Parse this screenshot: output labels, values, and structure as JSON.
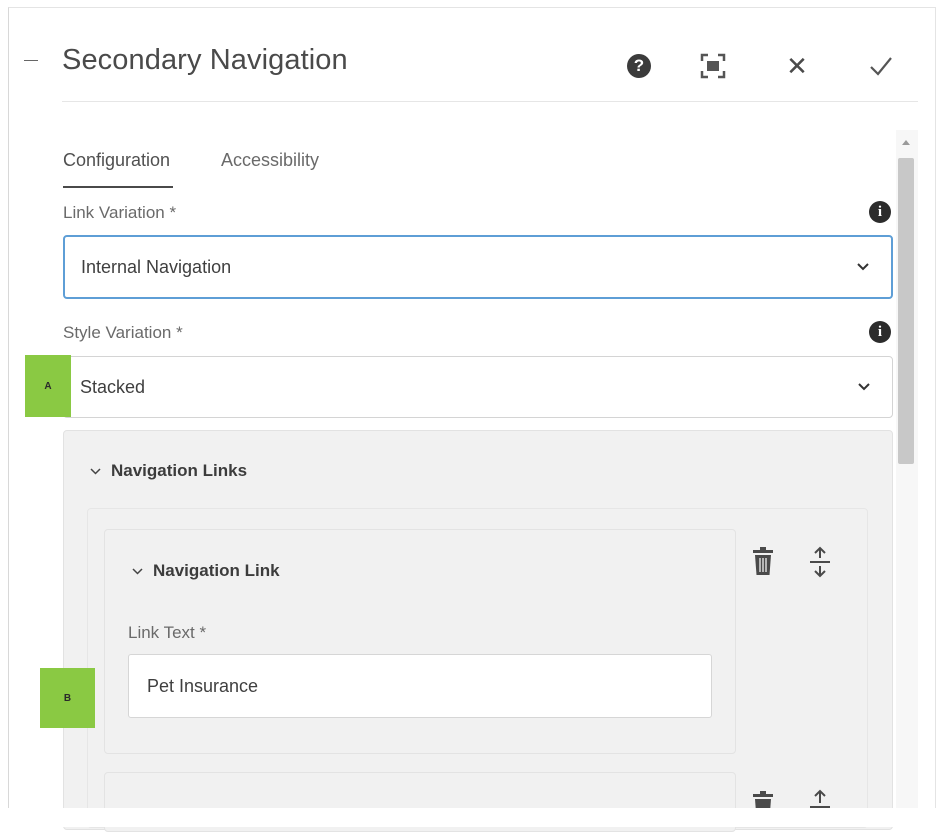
{
  "dialog": {
    "title": "Secondary Navigation",
    "icons": {
      "collapse": "minus-icon",
      "help": "help-icon",
      "help_glyph": "?",
      "fullscreen": "fullscreen-icon",
      "close": "close-icon",
      "close_glyph": "✕",
      "done": "checkmark-icon"
    }
  },
  "tabs": [
    {
      "label": "Configuration",
      "active": true
    },
    {
      "label": "Accessibility",
      "active": false
    }
  ],
  "fields": {
    "link_variation": {
      "label": "Link Variation *",
      "value": "Internal Navigation",
      "info_glyph": "i"
    },
    "style_variation": {
      "label": "Style Variation *",
      "value": "Stacked",
      "info_glyph": "i"
    }
  },
  "markers": {
    "a": "A",
    "b": "B"
  },
  "navigation_links": {
    "heading": "Navigation Links",
    "items": [
      {
        "heading": "Navigation Link",
        "link_text_label": "Link Text *",
        "link_text_value": "Pet Insurance"
      }
    ]
  },
  "colors": {
    "accent_focus": "#5e9ed6",
    "marker_green": "#8ac943"
  }
}
